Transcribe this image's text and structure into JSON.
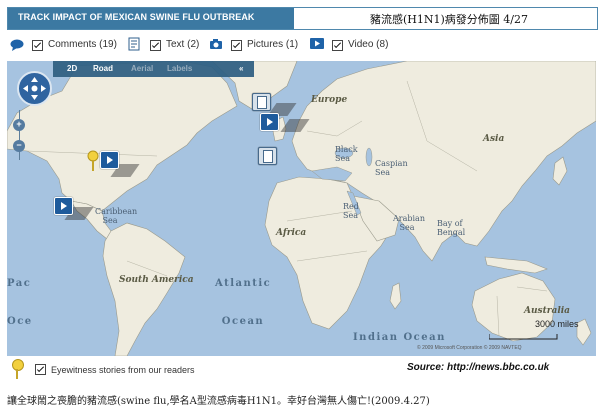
{
  "header": {
    "title": "TRACK IMPACT OF MEXICAN SWINE FLU OUTBREAK",
    "note": "豬流感(H1N1)病發分佈圖  4/27"
  },
  "filters": [
    {
      "icon": "speech-bubble-icon",
      "label": "Comments (19)",
      "checked": true
    },
    {
      "icon": "text-document-icon",
      "label": "Text (2)",
      "checked": true
    },
    {
      "icon": "camera-icon",
      "label": "Pictures (1)",
      "checked": true
    },
    {
      "icon": "video-play-icon",
      "label": "Video (8)",
      "checked": true
    }
  ],
  "map_controls": {
    "view_2d": "2D",
    "road": "Road",
    "aerial": "Aerial",
    "labels": "Labels",
    "collapse": "«",
    "zoom_in": "+",
    "zoom_out": "−"
  },
  "map_labels": {
    "europe": "Europe",
    "asia": "Asia",
    "africa": "Africa",
    "south_america": "South America",
    "australia": "Australia",
    "black_sea": "Black Sea",
    "caspian_sea": "Caspian Sea",
    "red_sea": "Red Sea",
    "arabian_sea": "Arabian Sea",
    "bay_of_bengal": "Bay of Bengal",
    "caribbean_sea": "Caribbean Sea",
    "atlantic_ocean": "Atlantic Ocean",
    "indian_ocean": "Indian Ocean",
    "pacific_ocean": "Pacific Ocean"
  },
  "scale": "3000 miles",
  "copyright": "© 2009 Microsoft Corporation   © 2009 NAVTEQ",
  "colors": {
    "header_band": "#3c79a2",
    "water": "#a6c3e0",
    "land": "#efecdf",
    "video_marker": "#1e5b9c"
  },
  "legend": {
    "checked": true,
    "label": "Eyewitness stories from our readers"
  },
  "source": "Source: http://news.bbc.co.uk",
  "caption": "讓全球鬧之喪膽的豬流感(swine flu,學名A型流感病毒H1N1。幸好台灣無人傷亡!(2009.4.27)"
}
